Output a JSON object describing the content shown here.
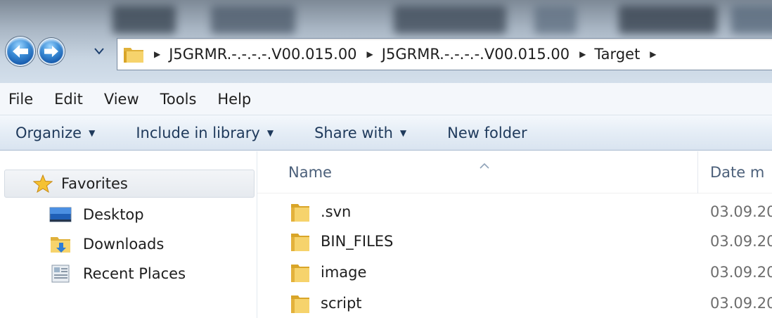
{
  "address": {
    "crumbs": [
      "J5GRMR.-.-.-.-.V00.015.00",
      "J5GRMR.-.-.-.-.V00.015.00",
      "Target"
    ]
  },
  "menu": [
    "File",
    "Edit",
    "View",
    "Tools",
    "Help"
  ],
  "commands": [
    "Organize",
    "Include in library",
    "Share with",
    "New folder"
  ],
  "nav": {
    "favorites": "Favorites",
    "items": [
      "Desktop",
      "Downloads",
      "Recent Places"
    ]
  },
  "columns": {
    "name": "Name",
    "date": "Date m"
  },
  "files": [
    {
      "name": ".svn",
      "date": "03.09.20"
    },
    {
      "name": "BIN_FILES",
      "date": "03.09.20"
    },
    {
      "name": "image",
      "date": "03.09.20"
    },
    {
      "name": "script",
      "date": "03.09.20"
    }
  ],
  "colors": {
    "command_text": "#1e395b",
    "column_header_text": "#4c607a",
    "folder_yellow": "#f2c94c"
  }
}
